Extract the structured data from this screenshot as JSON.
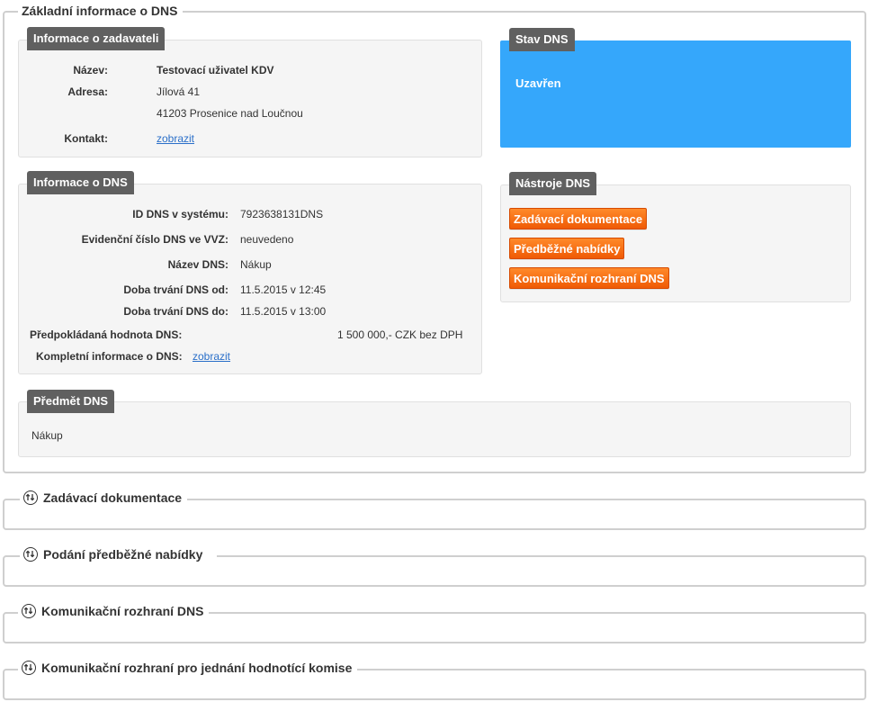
{
  "main": {
    "legend": "Základní informace o DNS"
  },
  "zadavatel": {
    "tag": "Informace o zadavateli",
    "name_label": "Název:",
    "name_value": "Testovací uživatel KDV",
    "address_label": "Adresa:",
    "address_line1": "Jílová 41",
    "address_line2": "41203 Prosenice nad Loučnou",
    "contact_label": "Kontakt:",
    "contact_link": "zobrazit"
  },
  "stav": {
    "tag": "Stav DNS",
    "value": "Uzavřen",
    "color": "#35a7fb"
  },
  "dns_info": {
    "tag": "Informace o DNS",
    "rows": [
      {
        "label": "ID DNS v systému:",
        "value": "7923638131DNS"
      },
      {
        "label": "Evidenční číslo DNS ve VVZ:",
        "value": "neuvedeno"
      },
      {
        "label": "Název DNS:",
        "value": "Nákup"
      },
      {
        "label": "Doba trvání DNS od:",
        "value": "11.5.2015 v 12:45"
      },
      {
        "label": "Doba trvání DNS do:",
        "value": "11.5.2015 v 13:00"
      }
    ],
    "estimated_label": "Předpokládaná hodnota DNS:",
    "estimated_value": "1 500 000,- CZK bez DPH",
    "complete_label": "Kompletní informace o DNS:",
    "complete_link": "zobrazit"
  },
  "tools": {
    "tag": "Nástroje DNS",
    "buttons": [
      "Zadávací dokumentace",
      "Předběžné nabídky",
      "Komunikační rozhraní DNS"
    ],
    "accent": "#f26a10"
  },
  "predmet": {
    "tag": "Předmět DNS",
    "value": "Nákup"
  },
  "sections": [
    {
      "title": "Zadávací dokumentace"
    },
    {
      "title": "Podání předběžné nabídky"
    },
    {
      "title": "Komunikační rozhraní DNS"
    },
    {
      "title": "Komunikační rozhraní pro jednání hodnotící komise"
    }
  ],
  "icons": {
    "section_toggle": "expand-collapse-icon"
  }
}
